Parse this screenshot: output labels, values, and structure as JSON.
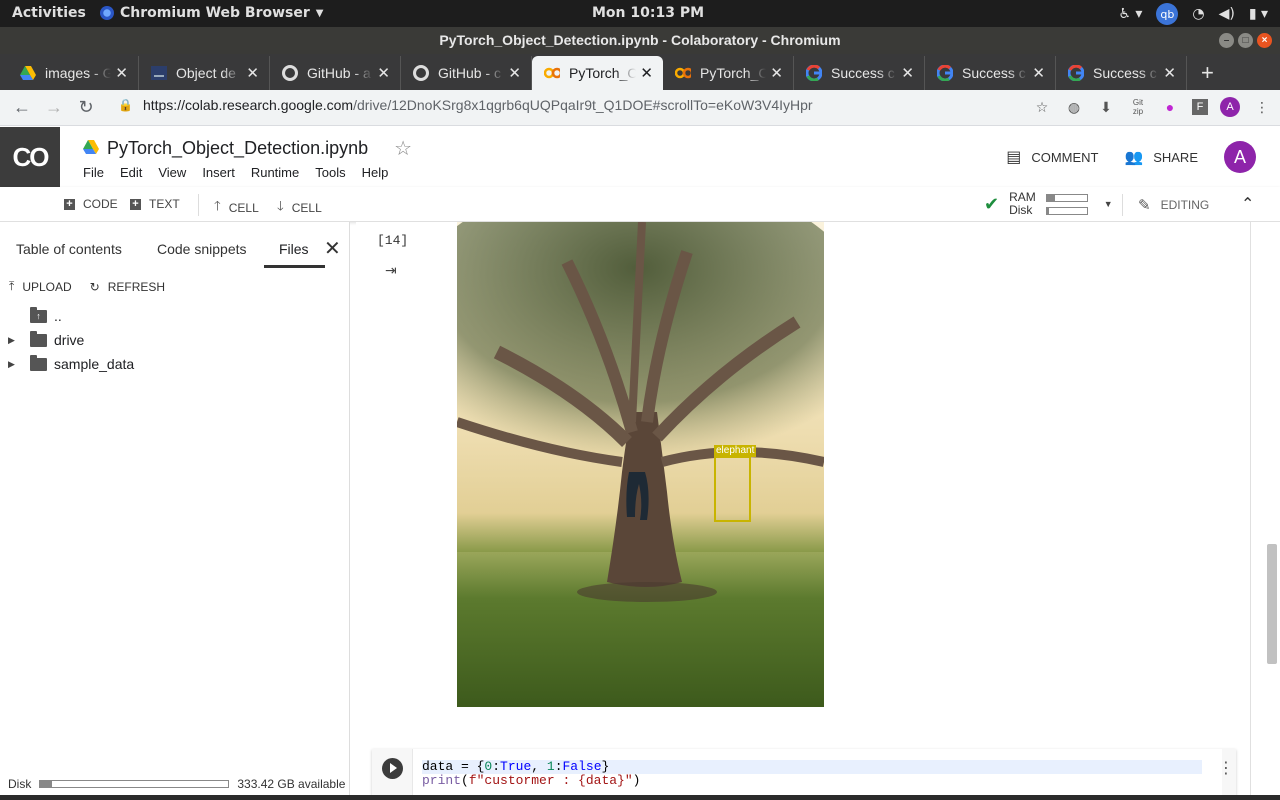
{
  "os_bar": {
    "activities": "Activities",
    "app_name": "Chromium Web Browser",
    "clock": "Mon 10:13 PM",
    "qb": "qb"
  },
  "window": {
    "title": "PyTorch_Object_Detection.ipynb - Colaboratory - Chromium"
  },
  "tabs": [
    {
      "label": "images - G",
      "icon": "drive-icon"
    },
    {
      "label": "Object de",
      "icon": "doc-icon"
    },
    {
      "label": "GitHub - a",
      "icon": "github-icon"
    },
    {
      "label": "GitHub - c",
      "icon": "github-icon"
    },
    {
      "label": "PyTorch_O",
      "icon": "colab-icon",
      "active": true
    },
    {
      "label": "PyTorch_C",
      "icon": "colab-icon"
    },
    {
      "label": "Success c",
      "icon": "google-icon"
    },
    {
      "label": "Success c",
      "icon": "google-icon"
    },
    {
      "label": "Success c",
      "icon": "google-icon"
    }
  ],
  "address": {
    "url_host": "https://colab.research.google.com",
    "url_path": "/drive/12DnoKSrg8x1qgrb6qUQPqaIr9t_Q1DOE#scrollTo=eKoW3V4IyHpr",
    "profile": "A"
  },
  "colab": {
    "logo": "CO",
    "notebook_title": "PyTorch_Object_Detection.ipynb",
    "menus": [
      "File",
      "Edit",
      "View",
      "Insert",
      "Runtime",
      "Tools",
      "Help"
    ],
    "comment": "COMMENT",
    "share": "SHARE",
    "avatar": "A"
  },
  "toolbar": {
    "code": "CODE",
    "text": "TEXT",
    "cell_up": "CELL",
    "cell_down": "CELL",
    "ram": "RAM",
    "disk": "Disk",
    "ram_usage": 0.2,
    "disk_usage": 0.05,
    "editing": "EDITING"
  },
  "sidebar": {
    "tabs": [
      "Table of contents",
      "Code snippets",
      "Files"
    ],
    "active_tab": "Files",
    "upload": "UPLOAD",
    "refresh": "REFRESH",
    "tree": [
      {
        "name": "..",
        "type": "parent"
      },
      {
        "name": "drive",
        "type": "folder"
      },
      {
        "name": "sample_data",
        "type": "folder"
      }
    ],
    "disk_label": "Disk",
    "disk_available": "333.42 GB available",
    "disk_usage": 0.06
  },
  "notebook": {
    "exec_count": "[14]",
    "detection_label": "elephant",
    "code_line1": {
      "a": "data = {",
      "b": "0",
      "c": ":",
      "d": "True",
      "e": ", ",
      "f": "1",
      "g": ":",
      "h": "False",
      "i": "}"
    },
    "code_line2": {
      "a": "print",
      "b": "(",
      "c": "f\"custormer : {data}\"",
      "d": ")"
    }
  }
}
